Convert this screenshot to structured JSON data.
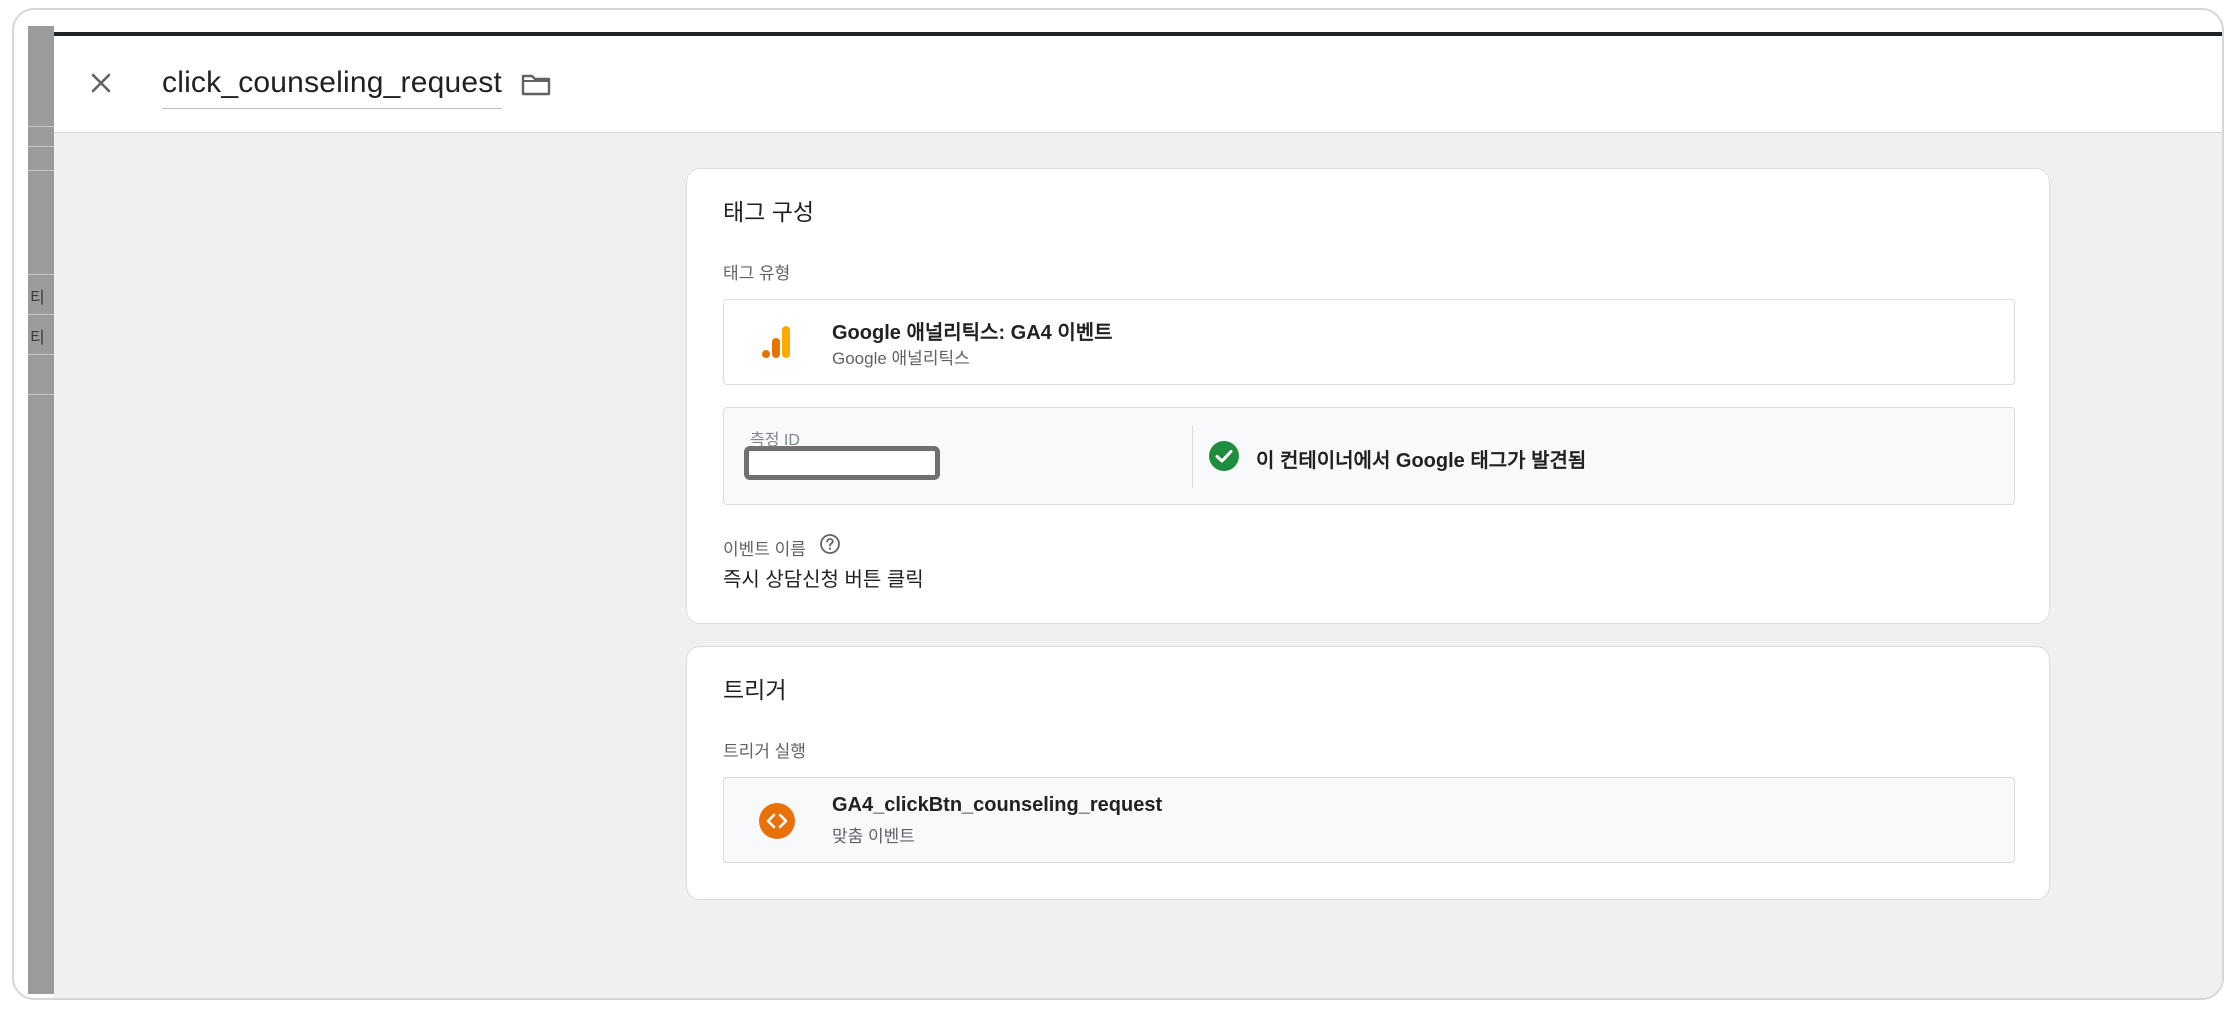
{
  "header": {
    "tag_name": "click_counseling_request"
  },
  "left_strip": {
    "chars": [
      "티",
      "티"
    ]
  },
  "tag_config": {
    "title": "태그 구성",
    "tag_type_label": "태그 유형",
    "tag_type": {
      "name": "Google 애널리틱스: GA4 이벤트",
      "sub": "Google 애널리틱스",
      "icon": "analytics-bar-icon"
    },
    "measurement_id_label": "측정 ID",
    "measurement_id_value": "",
    "google_tag_status": "이 컨테이너에서 Google 태그가 발견됨",
    "event_name_label": "이벤트 이름",
    "event_name_value": "즉시 상담신청 버튼 클릭"
  },
  "triggers": {
    "title": "트리거",
    "firing_label": "트리거 실행",
    "items": [
      {
        "name": "GA4_clickBtn_counseling_request",
        "type": "맞춤 이벤트",
        "icon": "custom-event-icon"
      }
    ]
  },
  "colors": {
    "accent_orange": "#e8710a",
    "success_green": "#1e8e3e",
    "analytics_yellow": "#f9ab00",
    "analytics_orange": "#e37400",
    "text_primary": "#202124",
    "text_secondary": "#5f6368",
    "background": "#eef0f1",
    "border": "#dadce0"
  }
}
